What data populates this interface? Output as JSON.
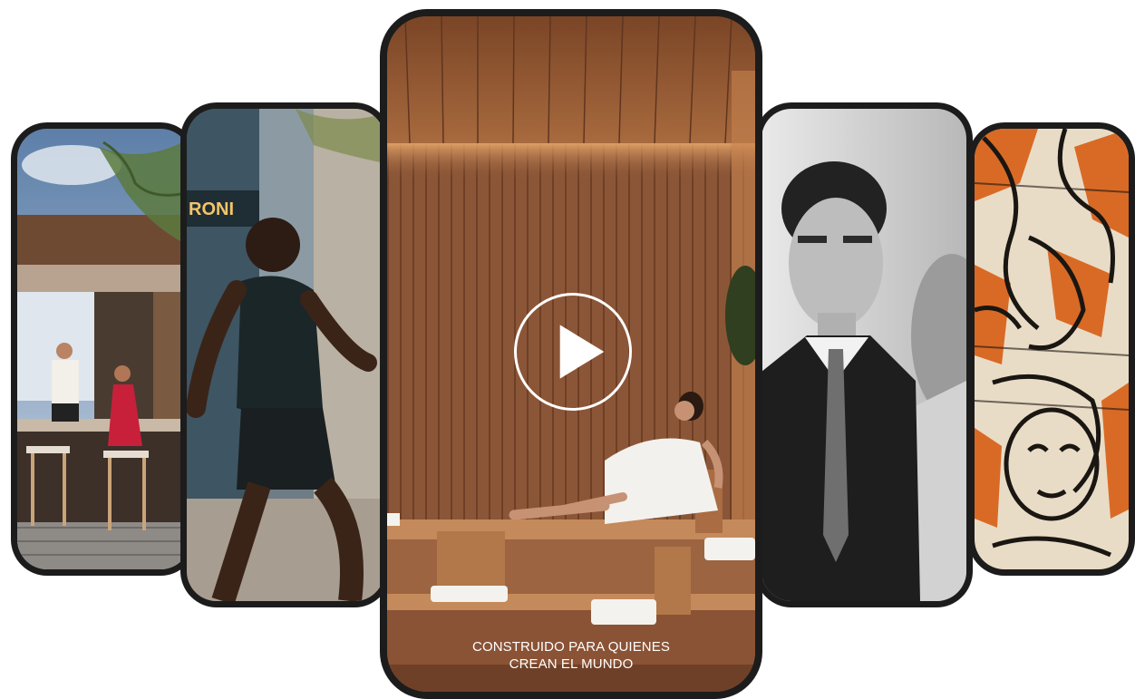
{
  "cards": [
    {
      "id": "rooftop-bar-card",
      "scene": "rooftop bar with bartender and guest"
    },
    {
      "id": "runner-card",
      "scene": "man sprinting on city street",
      "sign_text": "RONI"
    },
    {
      "id": "sauna-video-card",
      "scene": "woman relaxing in wooden sauna"
    },
    {
      "id": "businessman-card",
      "scene": "black and white portrait of man in suit"
    },
    {
      "id": "street-art-card",
      "scene": "abstract graffiti faces mural"
    }
  ],
  "video": {
    "play_icon": "play-icon",
    "caption_line1": "CONSTRUIDO PARA QUIENES",
    "caption_line2": "CREAN EL MUNDO"
  },
  "colors": {
    "frame": "#1d1c1c",
    "wood": "#8a5535",
    "caption": "#ffffff"
  }
}
